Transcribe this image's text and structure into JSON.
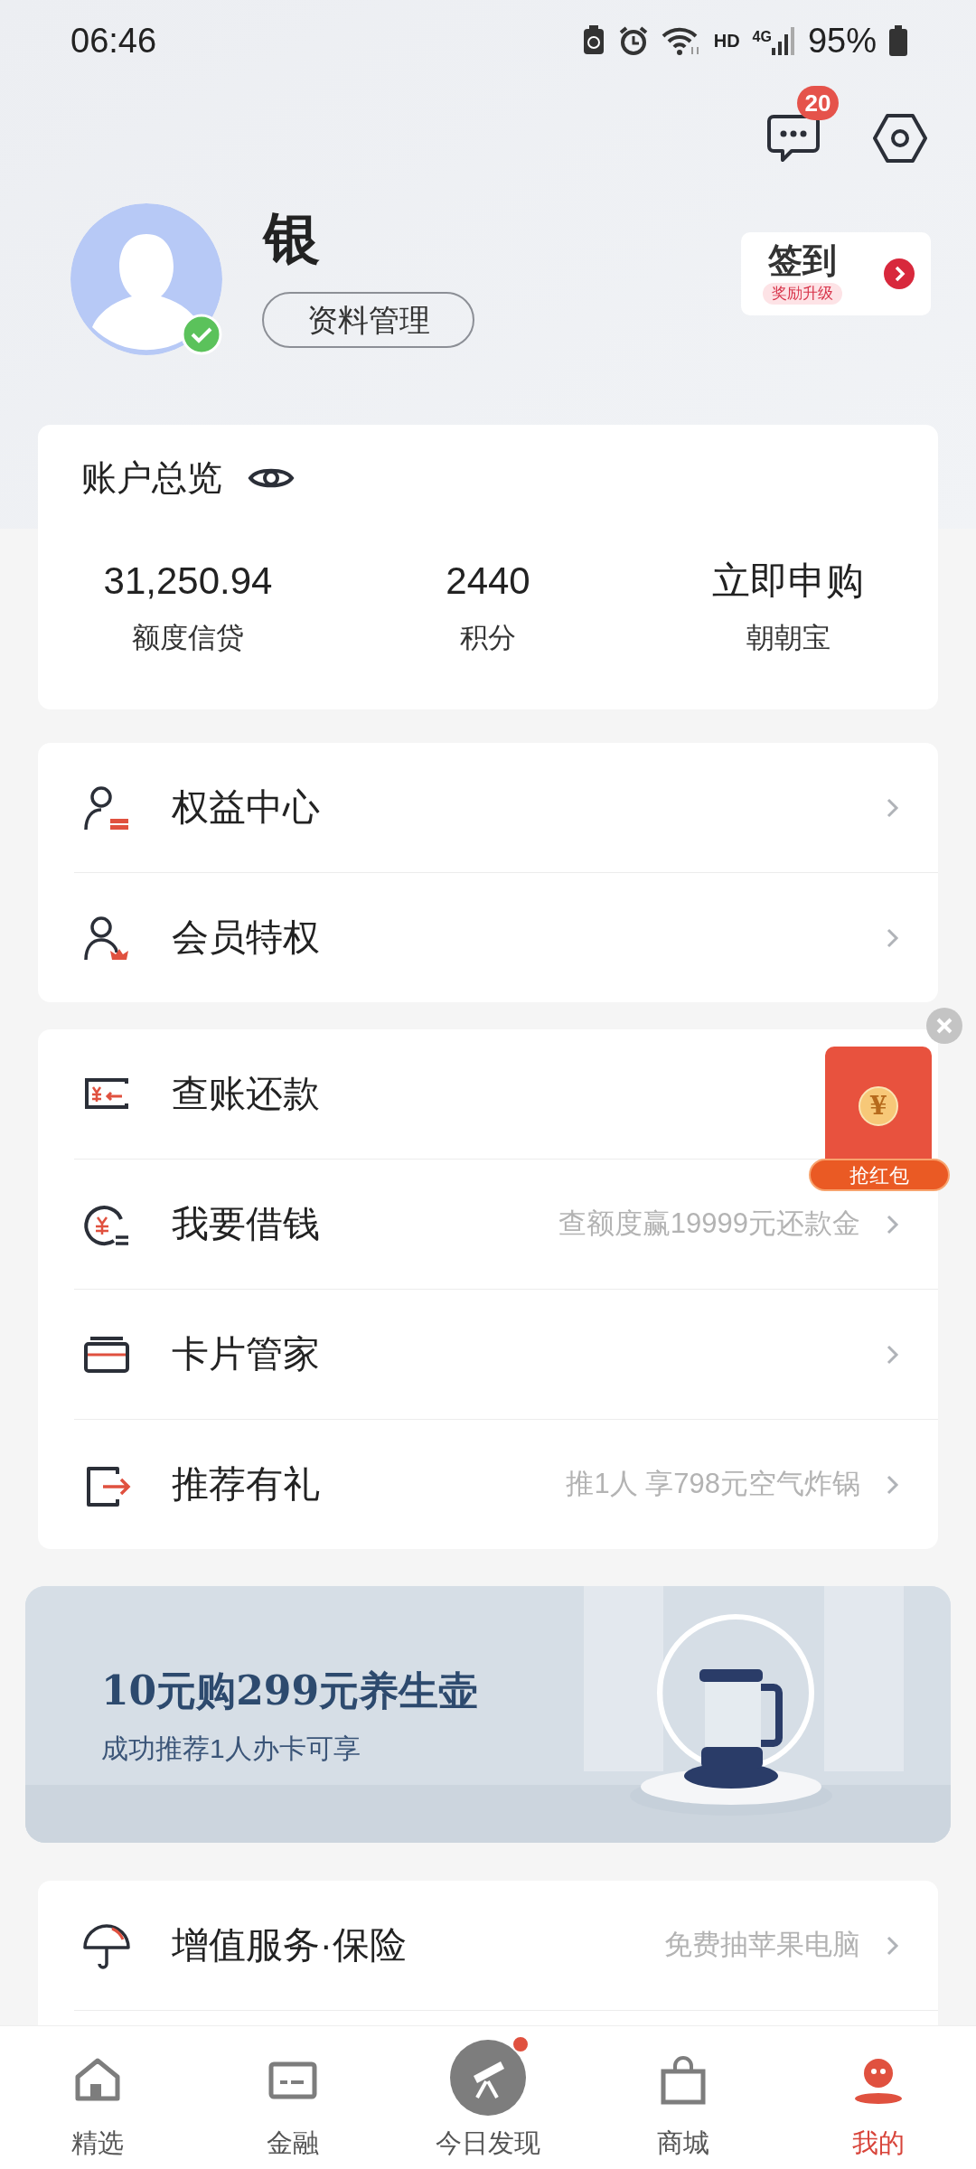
{
  "status_bar": {
    "time": "06:46",
    "hd": "HD",
    "network": "4G",
    "battery": "95%"
  },
  "header": {
    "message_badge": "20"
  },
  "profile": {
    "name": "银",
    "verified": true,
    "manage_button": "资料管理"
  },
  "checkin": {
    "title": "签到",
    "subtitle": "奖励升级"
  },
  "account": {
    "title": "账户总览",
    "stats": [
      {
        "value": "31,250.94",
        "label": "额度信贷"
      },
      {
        "value": "2440",
        "label": "积分"
      },
      {
        "value": "立即申购",
        "label": "朝朝宝"
      }
    ]
  },
  "menu_groups": [
    {
      "items": [
        {
          "kind": "rights",
          "label": "权益中心",
          "chevron": true
        },
        {
          "kind": "member",
          "label": "会员特权",
          "chevron": true
        }
      ]
    },
    {
      "items": [
        {
          "kind": "bill",
          "label": "查账还款",
          "chevron": false
        },
        {
          "kind": "borrow",
          "label": "我要借钱",
          "hint": "查额度赢19999元还款金",
          "chevron": true
        },
        {
          "kind": "card",
          "label": "卡片管家",
          "chevron": true
        },
        {
          "kind": "refer",
          "label": "推荐有礼",
          "hint": "推1人 享798元空气炸锅",
          "chevron": true
        }
      ]
    }
  ],
  "floating_promo": {
    "coin": "¥",
    "label": "抢红包"
  },
  "banner": {
    "title": "10元购299元养生壶",
    "subtitle": "成功推荐1人办卡可享"
  },
  "services": {
    "items": [
      {
        "kind": "umbrella",
        "label": "增值服务·保险",
        "hint": "免费抽苹果电脑",
        "chevron": true
      }
    ]
  },
  "bottom_nav": [
    {
      "kind": "home",
      "label": "精选",
      "selected": false,
      "dot": false
    },
    {
      "kind": "finance",
      "label": "金融",
      "selected": false,
      "dot": false
    },
    {
      "kind": "discover",
      "label": "今日发现",
      "selected": false,
      "dot": true
    },
    {
      "kind": "shop",
      "label": "商城",
      "selected": false,
      "dot": false
    },
    {
      "kind": "me",
      "label": "我的",
      "selected": true,
      "dot": false
    }
  ]
}
